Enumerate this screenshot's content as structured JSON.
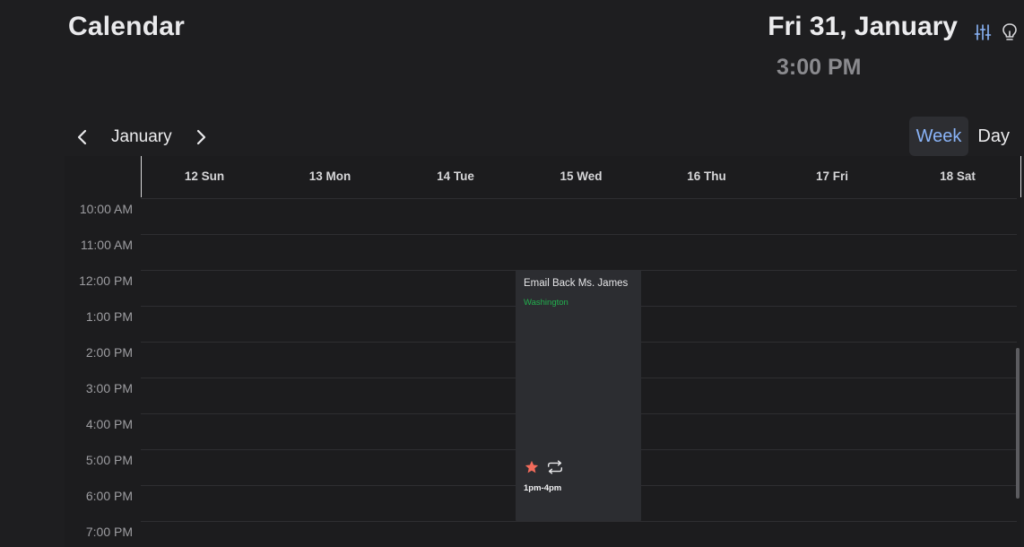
{
  "app": {
    "title": "Calendar"
  },
  "header": {
    "today_date": "Fri 31, January",
    "current_time": "3:00 PM",
    "settings_icon": "sliders-icon",
    "tips_icon": "lightbulb-icon"
  },
  "nav": {
    "month": "January",
    "prev_icon": "chevron-left-icon",
    "next_icon": "chevron-right-icon"
  },
  "view_toggle": {
    "week_label": "Week",
    "day_label": "Day",
    "active": "Week"
  },
  "week": {
    "days": [
      "12 Sun",
      "13 Mon",
      "14 Tue",
      "15 Wed",
      "16 Thu",
      "17 Fri",
      "18 Sat"
    ]
  },
  "hours": [
    "10:00 AM",
    "11:00 AM",
    "12:00 PM",
    "1:00 PM",
    "2:00 PM",
    "3:00 PM",
    "4:00 PM",
    "5:00 PM",
    "6:00 PM",
    "7:00 PM"
  ],
  "event": {
    "title": "Email Back Ms. James",
    "location": "Washington",
    "time": "1pm-4pm",
    "day": "15 Wed",
    "starred": true,
    "recurring": true,
    "icons": [
      "star-icon",
      "repeat-icon"
    ]
  },
  "colors": {
    "background": "#1e1e20",
    "accent": "#8ab4f8",
    "event_bg": "#2c2d31",
    "location": "#22b04e",
    "star": "#f26b5b"
  }
}
